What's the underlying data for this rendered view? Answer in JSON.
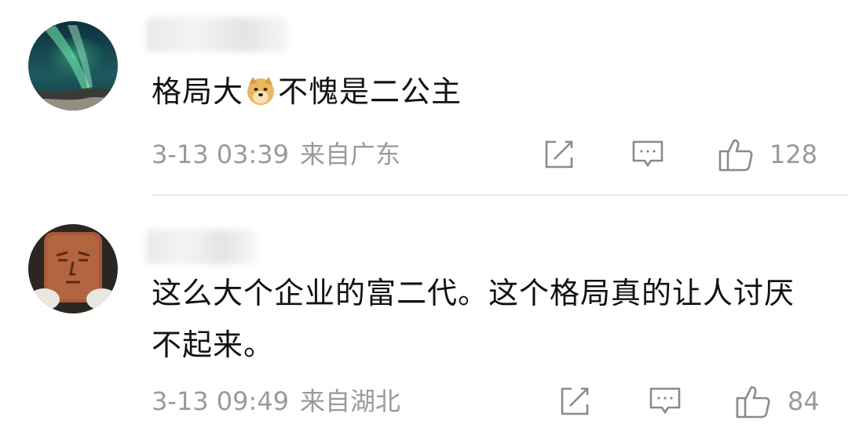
{
  "comments": [
    {
      "text_before_emoji": "格局大",
      "emoji": "doge-emoji",
      "text_after_emoji": "不愧是二公主",
      "timestamp": "3-13 03:39",
      "location": "来自广东",
      "likes": "128"
    },
    {
      "text": "这么大个企业的富二代。这个格局真的让人讨厌不起来。",
      "timestamp": "3-13 09:49",
      "location": "来自湖北",
      "likes": "84"
    }
  ],
  "icons": {
    "share": "share-edit-icon",
    "reply": "comment-bubble-icon",
    "like": "thumbs-up-icon"
  },
  "colors": {
    "text": "#111111",
    "meta": "#9a9a9a",
    "divider": "#ececec"
  }
}
